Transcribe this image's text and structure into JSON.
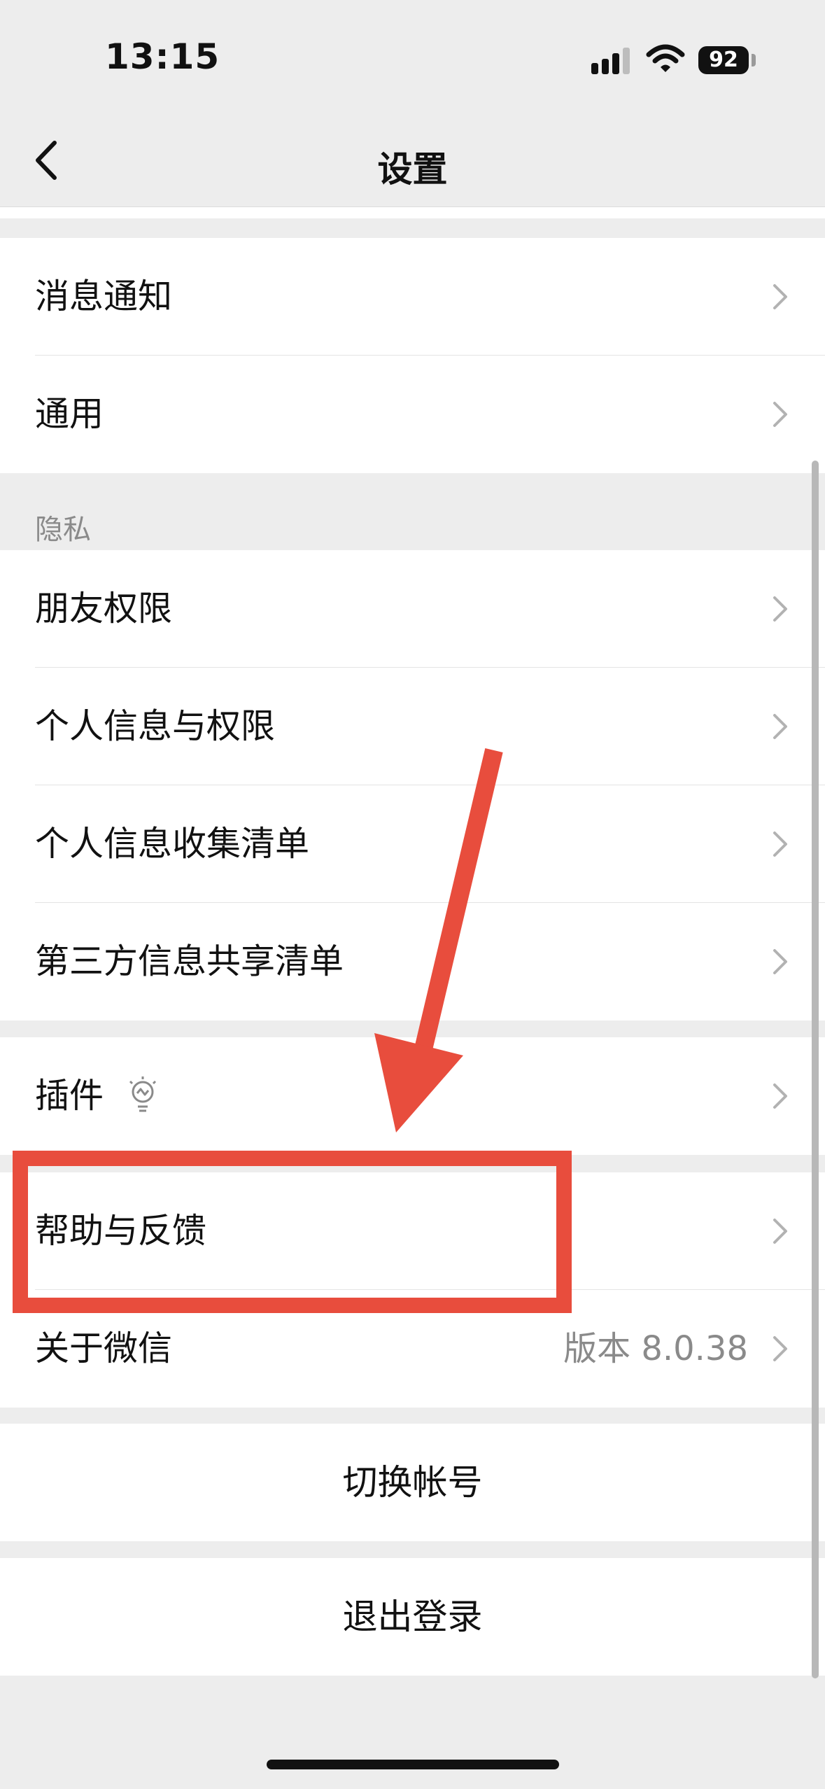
{
  "status_bar": {
    "time": "13:15",
    "battery": "92"
  },
  "nav": {
    "title": "设置"
  },
  "group1": [
    {
      "label": "消息通知"
    },
    {
      "label": "通用"
    }
  ],
  "privacy_header": "隐私",
  "privacy_items": [
    {
      "label": "朋友权限"
    },
    {
      "label": "个人信息与权限"
    },
    {
      "label": "个人信息收集清单"
    },
    {
      "label": "第三方信息共享清单"
    }
  ],
  "plugins": {
    "label": "插件"
  },
  "help": {
    "label": "帮助与反馈"
  },
  "about": {
    "label": "关于微信",
    "version": "版本 8.0.38"
  },
  "switch_account": "切换帐号",
  "logout": "退出登录",
  "colors": {
    "annotation": "#e84d3d",
    "background": "#ededed"
  }
}
